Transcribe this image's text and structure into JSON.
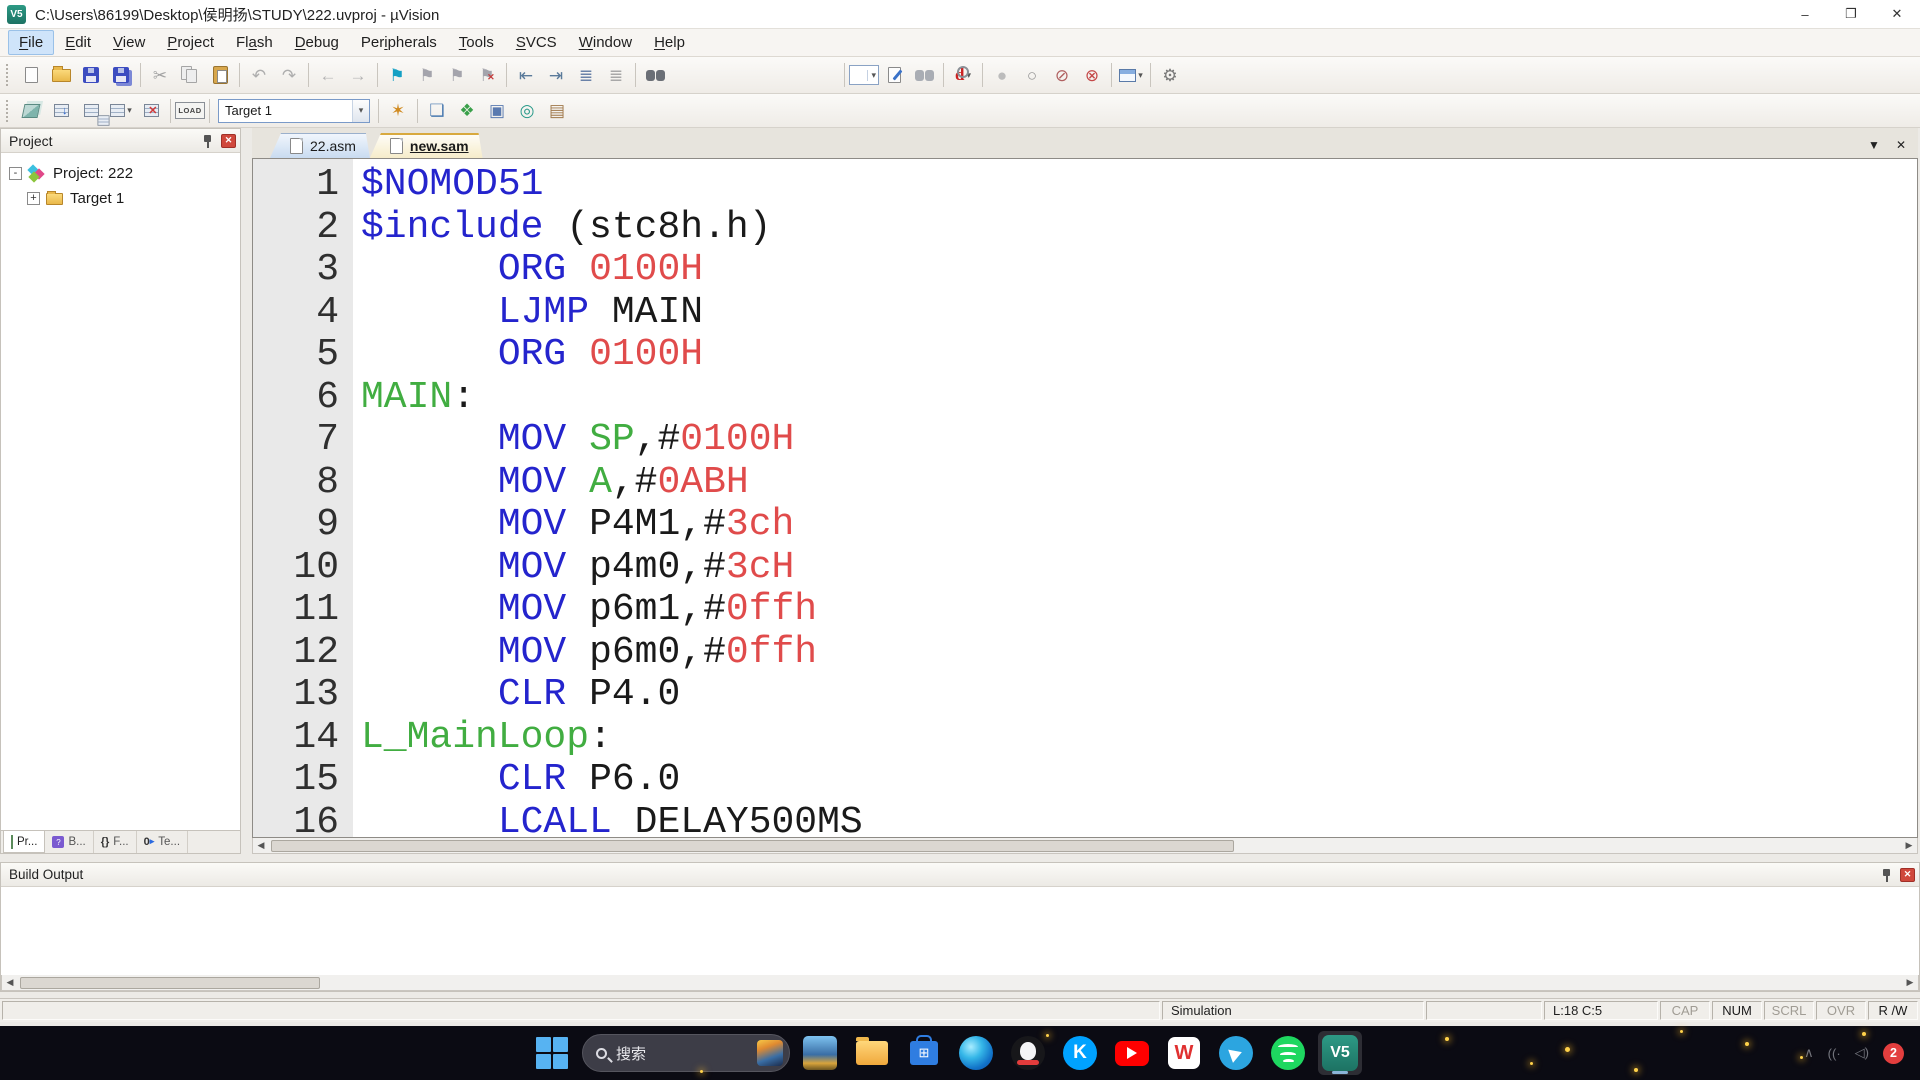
{
  "window": {
    "title": "C:\\Users\\86199\\Desktop\\侯明扬\\STUDY\\222.uvproj - µVision"
  },
  "menu": {
    "items": [
      {
        "label": "File",
        "accel": "F",
        "highlighted": true
      },
      {
        "label": "Edit",
        "accel": "E"
      },
      {
        "label": "View",
        "accel": "V"
      },
      {
        "label": "Project",
        "accel": "P"
      },
      {
        "label": "Flash",
        "accel": "a"
      },
      {
        "label": "Debug",
        "accel": "D"
      },
      {
        "label": "Peripherals",
        "accel": "i"
      },
      {
        "label": "Tools",
        "accel": "T"
      },
      {
        "label": "SVCS",
        "accel": "S"
      },
      {
        "label": "Window",
        "accel": "W"
      },
      {
        "label": "Help",
        "accel": "H"
      }
    ]
  },
  "toolbars": {
    "main": {
      "groups": [
        [
          "new-file",
          "open-file",
          "save",
          "save-all"
        ],
        [
          "cut",
          "copy",
          "paste"
        ],
        [
          "undo",
          "redo"
        ],
        [
          "nav-back",
          "nav-forward"
        ],
        [
          "bookmark",
          "prev-bookmark",
          "next-bookmark",
          "clear-bookmarks"
        ],
        [
          "unindent",
          "indent",
          "comment",
          "uncomment"
        ],
        [
          "find-in-files"
        ],
        [
          "gap"
        ],
        [
          "find-combo",
          "find-doc",
          "find"
        ],
        [
          "debug-session"
        ],
        [
          "toggle-breakpoint",
          "enable-breakpoint",
          "disable-breakpoints",
          "kill-breakpoints"
        ],
        [
          "window-layout"
        ],
        [
          "configure"
        ]
      ]
    },
    "build": {
      "groups": [
        [
          "translate",
          "build",
          "rebuild",
          "batch-build",
          "stop-build"
        ],
        [
          "download"
        ],
        [
          "target-combo"
        ],
        [
          "options-for-target"
        ],
        [
          "file-extensions",
          "manage-rte",
          "select-packs",
          "pack-installer",
          "books"
        ]
      ],
      "target_value": "Target 1",
      "download_label": "LOAD"
    }
  },
  "project_panel": {
    "title": "Project",
    "tree": {
      "root": {
        "label": "Project: 222",
        "expander": "-"
      },
      "child": {
        "label": "Target 1",
        "expander": "+"
      }
    }
  },
  "editor": {
    "tabs": [
      {
        "label": "22.asm",
        "active": false
      },
      {
        "label": "new.sam",
        "active": true
      }
    ],
    "lines": [
      {
        "n": 1,
        "seg": [
          [
            "$NOMOD51",
            "dir"
          ]
        ]
      },
      {
        "n": 2,
        "seg": [
          [
            "$include",
            "dir"
          ],
          [
            " (stc8h.h)",
            "plain"
          ]
        ]
      },
      {
        "n": 3,
        "seg": [
          [
            "      ",
            "plain"
          ],
          [
            "ORG",
            "dir"
          ],
          [
            " ",
            "plain"
          ],
          [
            "0100H",
            "num"
          ]
        ]
      },
      {
        "n": 4,
        "seg": [
          [
            "      ",
            "plain"
          ],
          [
            "LJMP",
            "dir"
          ],
          [
            " ",
            "plain"
          ],
          [
            "MAIN",
            "plain"
          ]
        ]
      },
      {
        "n": 5,
        "seg": [
          [
            "      ",
            "plain"
          ],
          [
            "ORG",
            "dir"
          ],
          [
            " ",
            "plain"
          ],
          [
            "0100H",
            "num"
          ]
        ]
      },
      {
        "n": 6,
        "seg": [
          [
            "MAIN",
            "label"
          ],
          [
            ":",
            "plain"
          ]
        ]
      },
      {
        "n": 7,
        "seg": [
          [
            "      ",
            "plain"
          ],
          [
            "MOV",
            "dir"
          ],
          [
            " ",
            "plain"
          ],
          [
            "SP",
            "reg"
          ],
          [
            ",#",
            "plain"
          ],
          [
            "0100H",
            "num"
          ]
        ]
      },
      {
        "n": 8,
        "seg": [
          [
            "      ",
            "plain"
          ],
          [
            "MOV",
            "dir"
          ],
          [
            " ",
            "plain"
          ],
          [
            "A",
            "reg"
          ],
          [
            ",#",
            "plain"
          ],
          [
            "0ABH",
            "num"
          ]
        ]
      },
      {
        "n": 9,
        "seg": [
          [
            "      ",
            "plain"
          ],
          [
            "MOV",
            "dir"
          ],
          [
            " ",
            "plain"
          ],
          [
            "P4M1,#",
            "plain"
          ],
          [
            "3ch",
            "num"
          ]
        ]
      },
      {
        "n": 10,
        "seg": [
          [
            "      ",
            "plain"
          ],
          [
            "MOV",
            "dir"
          ],
          [
            " ",
            "plain"
          ],
          [
            "p4m0,#",
            "plain"
          ],
          [
            "3cH",
            "num"
          ]
        ]
      },
      {
        "n": 11,
        "seg": [
          [
            "      ",
            "plain"
          ],
          [
            "MOV",
            "dir"
          ],
          [
            " ",
            "plain"
          ],
          [
            "p6m1,#",
            "plain"
          ],
          [
            "0ffh",
            "num"
          ]
        ]
      },
      {
        "n": 12,
        "seg": [
          [
            "      ",
            "plain"
          ],
          [
            "MOV",
            "dir"
          ],
          [
            " ",
            "plain"
          ],
          [
            "p6m0,#",
            "plain"
          ],
          [
            "0ffh",
            "num"
          ]
        ]
      },
      {
        "n": 13,
        "seg": [
          [
            "      ",
            "plain"
          ],
          [
            "CLR",
            "dir"
          ],
          [
            " ",
            "plain"
          ],
          [
            "P4.0",
            "plain"
          ]
        ]
      },
      {
        "n": 14,
        "seg": [
          [
            "L_MainLoop",
            "label"
          ],
          [
            ":",
            "plain"
          ]
        ]
      },
      {
        "n": 15,
        "seg": [
          [
            "      ",
            "plain"
          ],
          [
            "CLR",
            "dir"
          ],
          [
            " ",
            "plain"
          ],
          [
            "P6.0",
            "plain"
          ]
        ]
      },
      {
        "n": 16,
        "seg": [
          [
            "      ",
            "plain"
          ],
          [
            "LCALL",
            "dir"
          ],
          [
            " ",
            "plain"
          ],
          [
            "DELAY500MS",
            "plain"
          ]
        ]
      }
    ]
  },
  "panel_tabs": [
    {
      "label": "Pr...",
      "icon": "project-tab",
      "active": true
    },
    {
      "label": "B...",
      "icon": "books-tab",
      "active": false
    },
    {
      "label": "F...",
      "icon": "functions-tab",
      "active": false
    },
    {
      "label": "Te...",
      "icon": "templates-tab",
      "active": false
    }
  ],
  "build_output": {
    "title": "Build Output",
    "content": ""
  },
  "status_bar": {
    "simulation": "Simulation",
    "cursor": "L:18 C:5",
    "flags": [
      {
        "label": "CAP",
        "active": false
      },
      {
        "label": "NUM",
        "active": true
      },
      {
        "label": "SCRL",
        "active": false
      },
      {
        "label": "OVR",
        "active": false
      },
      {
        "label": "R /W",
        "active": true
      }
    ]
  },
  "taskbar": {
    "search_label": "搜索",
    "notification_badge": "2",
    "items": [
      {
        "name": "start"
      },
      {
        "name": "search"
      },
      {
        "name": "widgets"
      },
      {
        "name": "file-explorer"
      },
      {
        "name": "microsoft-store"
      },
      {
        "name": "edge"
      },
      {
        "name": "qq"
      },
      {
        "name": "kugou"
      },
      {
        "name": "youtube"
      },
      {
        "name": "wps-office"
      },
      {
        "name": "telegram"
      },
      {
        "name": "spotify"
      },
      {
        "name": "uvision",
        "active": true
      }
    ]
  },
  "colors": {
    "dir": "#2424cd",
    "num": "#e04b4b",
    "label": "#41ad41",
    "reg": "#41ad41",
    "plain": "#1a1a1a",
    "tab_active_border": "#d8a93e",
    "bookmark_accent": "#14a0c4",
    "close_button": "#d0483c"
  }
}
